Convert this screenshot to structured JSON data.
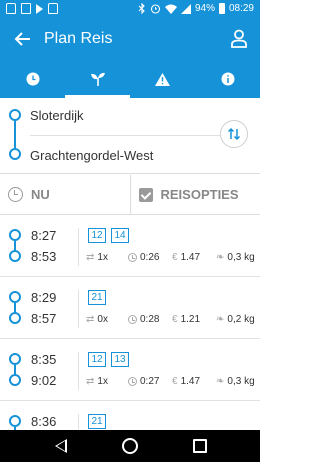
{
  "status_bar": {
    "battery": "94%",
    "time": "08:29",
    "background": "#1692d8"
  },
  "app_bar": {
    "title": "Plan Reis"
  },
  "tabs": [
    {
      "icon": "clock-icon",
      "active": false
    },
    {
      "icon": "sprout-icon",
      "active": true
    },
    {
      "icon": "warning-icon",
      "active": false
    },
    {
      "icon": "info-icon",
      "active": false
    }
  ],
  "route": {
    "from": "Sloterdijk",
    "to": "Grachtengordel-West"
  },
  "options": {
    "time_label": "NU",
    "settings_label": "REISOPTIES"
  },
  "trips": [
    {
      "depart": "8:27",
      "arrive": "8:53",
      "lines": [
        "12",
        "14"
      ],
      "transfers": "1x",
      "duration": "0:26",
      "price": "1.47",
      "co2": "0,3 kg"
    },
    {
      "depart": "8:29",
      "arrive": "8:57",
      "lines": [
        "21"
      ],
      "transfers": "0x",
      "duration": "0:28",
      "price": "1.21",
      "co2": "0,2 kg"
    },
    {
      "depart": "8:35",
      "arrive": "9:02",
      "lines": [
        "12",
        "13"
      ],
      "transfers": "1x",
      "duration": "0:27",
      "price": "1.47",
      "co2": "0,3 kg"
    },
    {
      "depart": "8:36",
      "arrive": "",
      "lines": [
        "21"
      ],
      "transfers": "",
      "duration": "",
      "price": "",
      "co2": ""
    }
  ],
  "colors": {
    "primary": "#1692d8",
    "text": "#333333",
    "muted": "#888888"
  }
}
